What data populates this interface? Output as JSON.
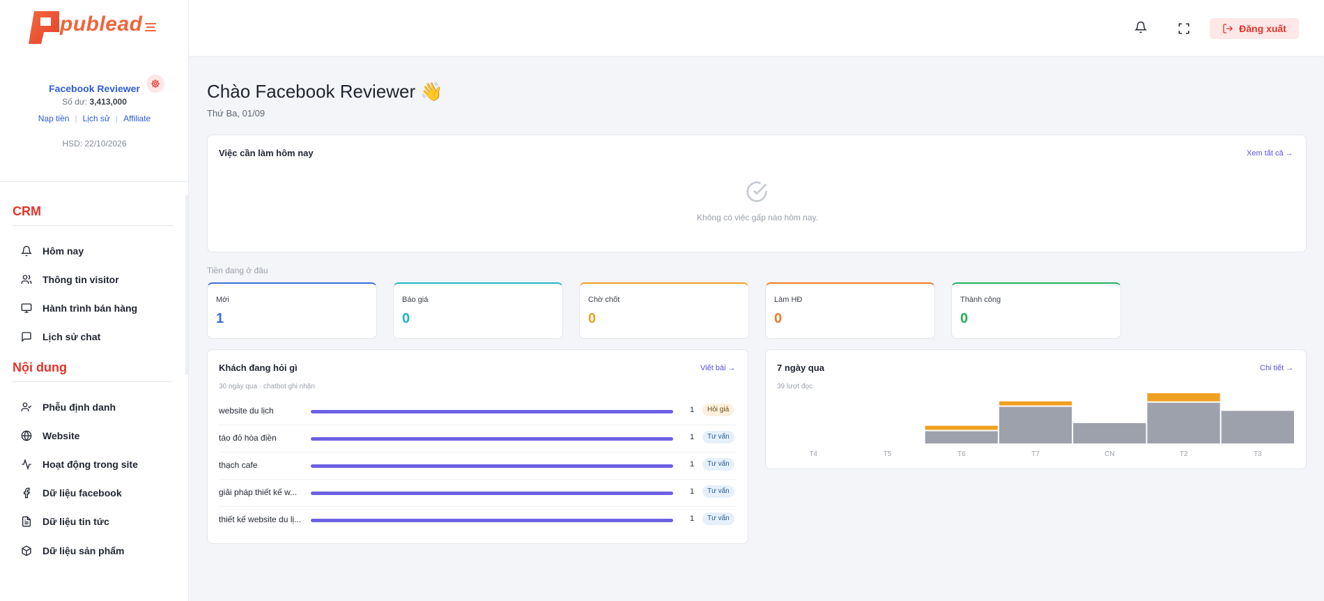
{
  "brand": {
    "name": "publead"
  },
  "user": {
    "name": "Facebook Reviewer",
    "balance_label": "Số dư:",
    "balance_value": "3,413,000",
    "links": [
      "Nạp tiền",
      "Lịch sử",
      "Affiliate"
    ],
    "expiry": "HSD: 22/10/2026"
  },
  "sidebar": {
    "sections": [
      {
        "title": "CRM",
        "items": [
          {
            "label": "Hôm nay",
            "icon": "bell-icon"
          },
          {
            "label": "Thông tin visitor",
            "icon": "users-icon"
          },
          {
            "label": "Hành trình bán hàng",
            "icon": "monitor-icon"
          },
          {
            "label": "Lịch sử chat",
            "icon": "chat-icon"
          }
        ]
      },
      {
        "title": "Nội dung",
        "items": [
          {
            "label": "Phễu định danh",
            "icon": "user-check-icon"
          },
          {
            "label": "Website",
            "icon": "globe-icon"
          },
          {
            "label": "Hoạt động trong site",
            "icon": "activity-icon"
          },
          {
            "label": "Dữ liệu facebook",
            "icon": "facebook-icon"
          },
          {
            "label": "Dữ liệu tin tức",
            "icon": "file-text-icon"
          },
          {
            "label": "Dữ liệu sản phẩm",
            "icon": "package-icon"
          }
        ]
      }
    ]
  },
  "header": {
    "logout_label": "Đăng xuất"
  },
  "main": {
    "greeting": "Chào Facebook Reviewer 👋",
    "date": "Thứ Ba, 01/09",
    "todo": {
      "title": "Việc cần làm hôm nay",
      "link": "Xem tất cả →",
      "empty": "Không có việc gấp nào hôm nay."
    },
    "money_label": "Tiền đang ở đâu",
    "stats": [
      {
        "label": "Mới",
        "value": "1",
        "color": "#3b6fd8"
      },
      {
        "label": "Báo giá",
        "value": "0",
        "color": "#1fb6c1"
      },
      {
        "label": "Chờ chốt",
        "value": "0",
        "color": "#f0a020"
      },
      {
        "label": "Làm HĐ",
        "value": "0",
        "color": "#f07a2a"
      },
      {
        "label": "Thành công",
        "value": "0",
        "color": "#22b05a"
      }
    ],
    "questions": {
      "title": "Khách đang hỏi gì",
      "link": "Viết bài →",
      "subtitle": "30 ngày qua · chatbot ghi nhận",
      "rows": [
        {
          "text": "website du lịch",
          "count": "1",
          "tag": "Hỏi giá",
          "tag_type": "warm"
        },
        {
          "text": "táo đỏ hòa điền",
          "count": "1",
          "tag": "Tư vấn",
          "tag_type": "info"
        },
        {
          "text": "thạch cafe",
          "count": "1",
          "tag": "Tư vấn",
          "tag_type": "info"
        },
        {
          "text": "giải pháp thiết kế w...",
          "count": "1",
          "tag": "Tư vấn",
          "tag_type": "info"
        },
        {
          "text": "thiết kế website du lị...",
          "count": "1",
          "tag": "Tư vấn",
          "tag_type": "info"
        }
      ]
    },
    "week": {
      "title": "7 ngày qua",
      "link": "Chi tiết →",
      "subtitle": "39 lượt đọc"
    }
  },
  "chart_data": {
    "type": "bar",
    "categories": [
      "T4",
      "T5",
      "T6",
      "T7",
      "CN",
      "T2",
      "T3"
    ],
    "series": [
      {
        "values": [
          0,
          0,
          3,
          9,
          5,
          10,
          8
        ],
        "color": "#9ca1ab"
      },
      {
        "values": [
          0,
          0,
          1,
          1,
          0,
          2,
          0
        ],
        "color": "#f0a020"
      }
    ],
    "ylim": [
      0,
      12
    ],
    "grid": false
  }
}
